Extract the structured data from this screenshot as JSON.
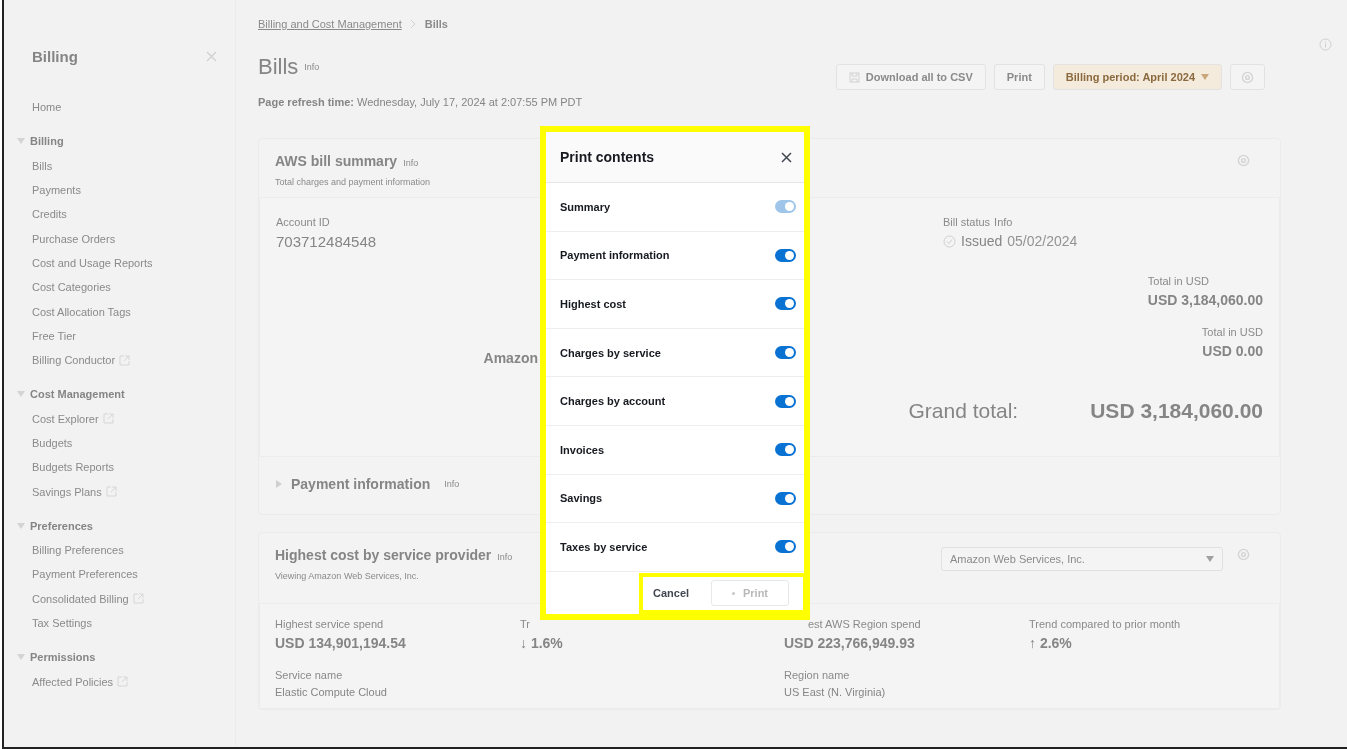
{
  "sidebar": {
    "title": "Billing",
    "home": "Home",
    "sections": [
      {
        "title": "Billing",
        "expanded": true,
        "items": [
          {
            "label": "Bills",
            "external": false
          },
          {
            "label": "Payments",
            "external": false
          },
          {
            "label": "Credits",
            "external": false
          },
          {
            "label": "Purchase Orders",
            "external": false
          },
          {
            "label": "Cost and Usage Reports",
            "external": false
          },
          {
            "label": "Cost Categories",
            "external": false
          },
          {
            "label": "Cost Allocation Tags",
            "external": false
          },
          {
            "label": "Free Tier",
            "external": false
          },
          {
            "label": "Billing Conductor",
            "external": true
          }
        ]
      },
      {
        "title": "Cost Management",
        "expanded": true,
        "items": [
          {
            "label": "Cost Explorer",
            "external": true
          },
          {
            "label": "Budgets",
            "external": false
          },
          {
            "label": "Budgets Reports",
            "external": false
          },
          {
            "label": "Savings Plans",
            "external": true
          }
        ]
      },
      {
        "title": "Preferences",
        "expanded": true,
        "items": [
          {
            "label": "Billing Preferences",
            "external": false
          },
          {
            "label": "Payment Preferences",
            "external": false
          },
          {
            "label": "Consolidated Billing",
            "external": true
          },
          {
            "label": "Tax Settings",
            "external": false
          }
        ]
      },
      {
        "title": "Permissions",
        "expanded": true,
        "items": [
          {
            "label": "Affected Policies",
            "external": true
          }
        ]
      }
    ]
  },
  "breadcrumb": [
    {
      "label": "Billing and Cost Management",
      "kind": "link"
    },
    {
      "label": "Bills",
      "kind": "current"
    }
  ],
  "page": {
    "title": "Bills",
    "info": "Info",
    "refresh": "**Page refresh time:** Wednesday, July 17, 2024 at 2:07:55 PM PDT"
  },
  "actions": {
    "download": "Download all to CSV",
    "print": "Print",
    "period": "Billing period: April 2024"
  },
  "summary": {
    "title": "AWS bill summary",
    "info": "Info",
    "subtitle": "Total charges and payment information",
    "account_label": "Account ID",
    "account_id": "703712484548",
    "amazon": "Amazon",
    "status_label": "Bill status",
    "status_info": "Info",
    "status": "Issued",
    "status_date": "05/02/2024",
    "totals": [
      {
        "label": "Total in USD",
        "value": "USD 3,184,060.00"
      },
      {
        "label": "Total in USD",
        "value": "USD 0.00"
      }
    ],
    "grand_label": "Grand total:",
    "grand_value": "USD 3,184,060.00"
  },
  "payment": {
    "title": "Payment information",
    "info": "Info",
    "expanded": false
  },
  "highest": {
    "title": "Highest cost by service provider",
    "info": "Info",
    "subtitle": "Viewing Amazon Web Services, Inc.",
    "select": "Amazon Web Services, Inc.",
    "metrics": [
      {
        "label": "Highest service spend",
        "value": "USD 134,901,194.54",
        "sub_label": "Service name",
        "sub_value": "Elastic Compute Cloud",
        "kind": "full"
      },
      {
        "label": "Tr",
        "value": "↓ 1.6%",
        "kind": "full"
      },
      {
        "label": "est AWS Region spend",
        "value": "USD 223,766,949.93",
        "sub_label": "Region name",
        "sub_value": "US East (N. Virginia)",
        "kind": "clipped"
      },
      {
        "label": "Trend compared to prior month",
        "value": "↑ 2.6%",
        "kind": "full"
      }
    ]
  },
  "dialog": {
    "title": "Print contents",
    "options": [
      {
        "label": "Summary",
        "on": true,
        "disabled": true
      },
      {
        "label": "Payment information",
        "on": true,
        "disabled": false
      },
      {
        "label": "Highest cost",
        "on": true,
        "disabled": false
      },
      {
        "label": "Charges by service",
        "on": true,
        "disabled": false
      },
      {
        "label": "Charges by account",
        "on": true,
        "disabled": false
      },
      {
        "label": "Invoices",
        "on": true,
        "disabled": false
      },
      {
        "label": "Savings",
        "on": true,
        "disabled": false
      },
      {
        "label": "Taxes by service",
        "on": true,
        "disabled": false
      }
    ],
    "cancel": "Cancel",
    "confirm": "Print",
    "confirm_disabled": true
  }
}
